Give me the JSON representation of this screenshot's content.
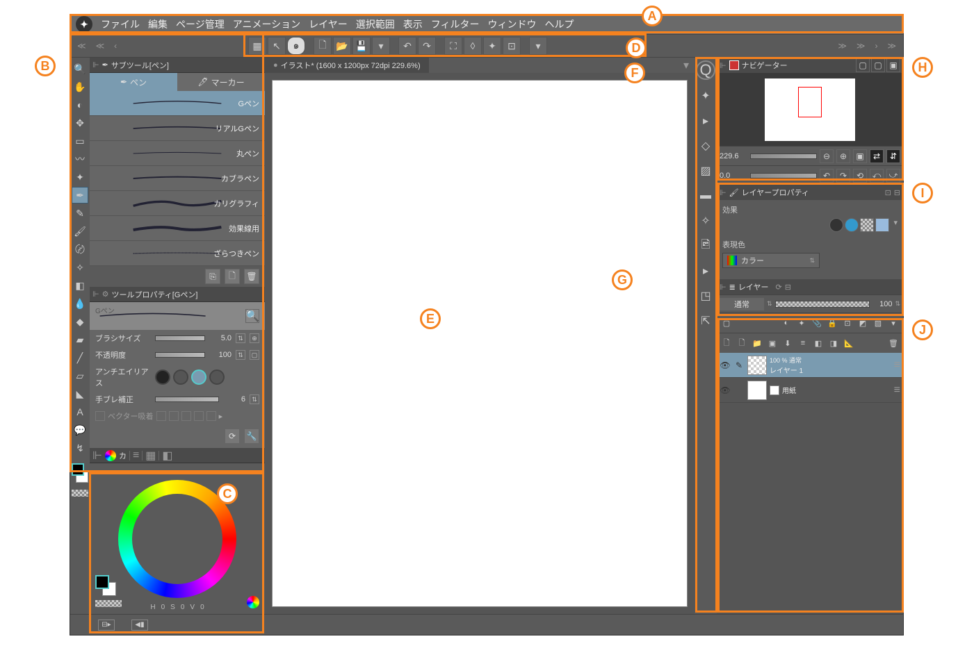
{
  "menubar": [
    "ファイル",
    "編集",
    "ページ管理",
    "アニメーション",
    "レイヤー",
    "選択範囲",
    "表示",
    "フィルター",
    "ウィンドウ",
    "ヘルプ"
  ],
  "doc_tab": "イラスト* (1600 x 1200px 72dpi 229.6%)",
  "subtool_panel": {
    "title": "サブツール[ペン]",
    "tabs": [
      {
        "label": "ペン",
        "active": true
      },
      {
        "label": "マーカー",
        "active": false
      }
    ],
    "items": [
      "Gペン",
      "リアルGペン",
      "丸ペン",
      "カブラペン",
      "カリグラフィ",
      "効果線用",
      "ざらつきペン"
    ]
  },
  "toolprop": {
    "title": "ツールプロパティ[Gペン]",
    "preview_name": "Gペン",
    "rows": {
      "brush_size_label": "ブラシサイズ",
      "brush_size_val": "5.0",
      "opacity_label": "不透明度",
      "opacity_val": "100",
      "aa_label": "アンチエイリアス",
      "stabilize_label": "手ブレ補正",
      "stabilize_val": "6",
      "vector_label": "ベクター吸着"
    }
  },
  "color": {
    "tab": "カ",
    "hsv": {
      "h_label": "H",
      "h": "0",
      "s_label": "S",
      "s": "0",
      "v_label": "V",
      "v": "0"
    }
  },
  "navigator": {
    "title": "ナビゲーター",
    "zoom": "229.6",
    "angle": "0.0"
  },
  "layer_prop": {
    "title": "レイヤープロパティ",
    "effect_label": "効果",
    "expr_label": "表現色",
    "expr_value": "カラー"
  },
  "layer_panel": {
    "title": "レイヤー",
    "blend": "通常",
    "opacity": "100",
    "layers": [
      {
        "opacity": "100 % 通常",
        "name": "レイヤー 1",
        "paper": false,
        "selected": true
      },
      {
        "opacity": "",
        "name": "用紙",
        "paper": true,
        "selected": false
      }
    ]
  },
  "callouts": {
    "A": "A",
    "B": "B",
    "C": "C",
    "D": "D",
    "E": "E",
    "F": "F",
    "G": "G",
    "H": "H",
    "I": "I",
    "J": "J"
  }
}
